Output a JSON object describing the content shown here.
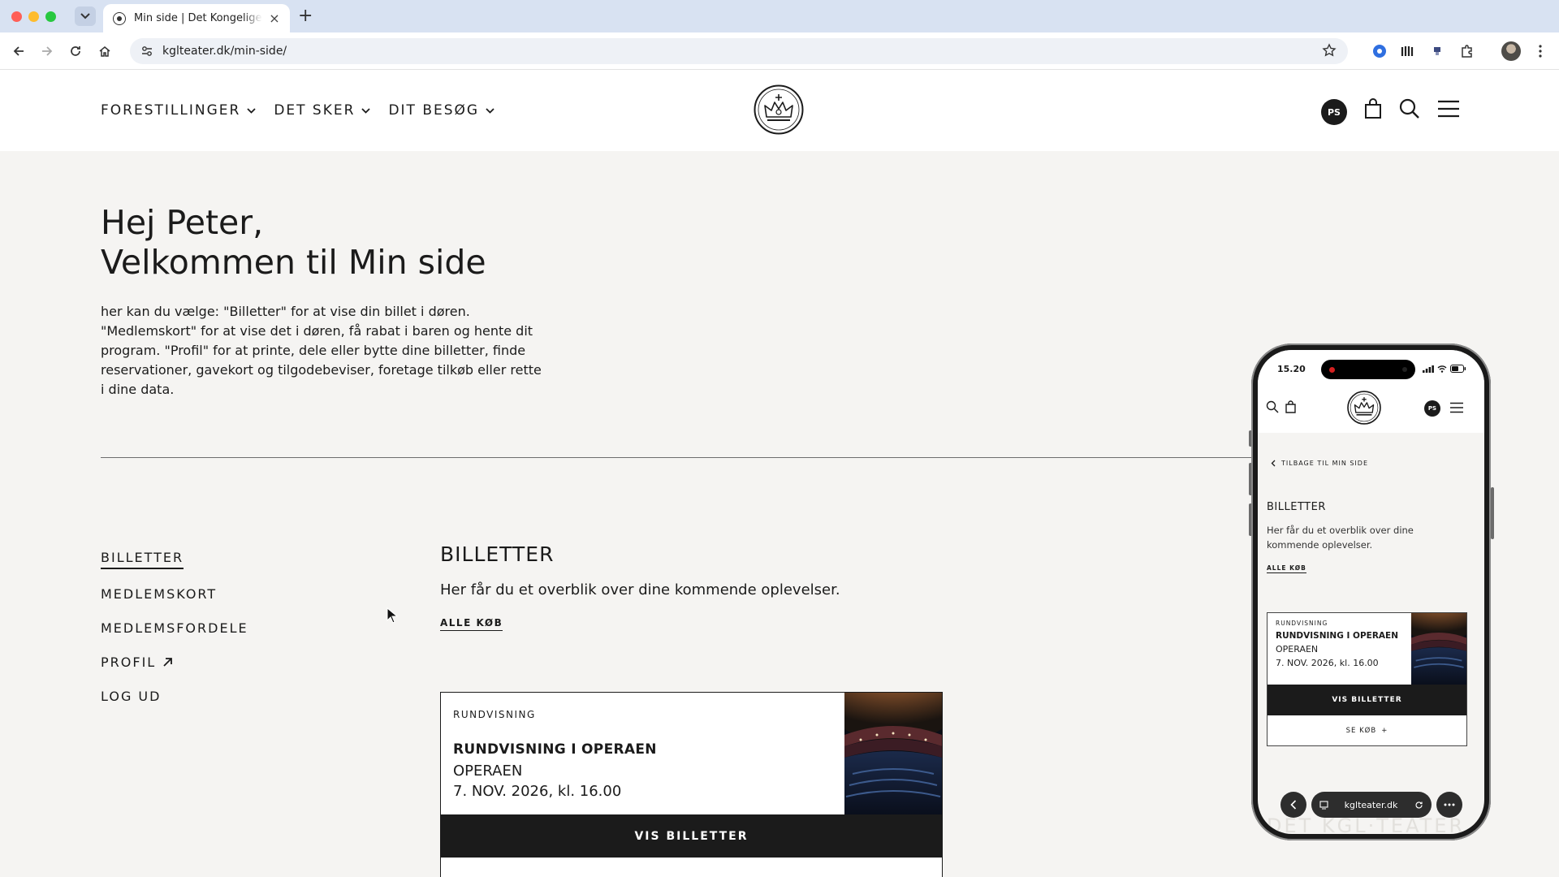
{
  "browser": {
    "tab_title": "Min side | Det Kongelige Teater",
    "url": "kglteater.dk/min-side/"
  },
  "header": {
    "nav": [
      {
        "label": "FORESTILLINGER"
      },
      {
        "label": "DET SKER"
      },
      {
        "label": "DIT BESØG"
      }
    ],
    "avatar_initials": "PS"
  },
  "hero": {
    "greeting_line1": "Hej Peter,",
    "greeting_line2": "Velkommen til Min side",
    "intro": "her kan du vælge: \"Billetter\" for at vise din billet i døren. \"Medlemskort\" for at vise det i døren, få rabat i baren og hente dit program. \"Profil\" for at printe, dele eller bytte dine billetter, finde reservationer, gavekort og tilgodebeviser, foretage tilkøb eller rette i dine data."
  },
  "side_menu": {
    "items": [
      {
        "label": "BILLETTER"
      },
      {
        "label": "MEDLEMSKORT"
      },
      {
        "label": "MEDLEMSFORDELE"
      },
      {
        "label": "PROFIL"
      },
      {
        "label": "LOG UD"
      }
    ]
  },
  "tickets": {
    "title": "BILLETTER",
    "description": "Her får du et overblik over dine kommende oplevelser.",
    "all_link": "ALLE KØB",
    "card": {
      "kicker": "RUNDVISNING",
      "title": "RUNDVISNING I OPERAEN",
      "venue": "OPERAEN",
      "date": "7. NOV. 2026, kl. 16.00",
      "button": "VIS BILLETTER"
    }
  },
  "phone": {
    "time": "15.20",
    "avatar_initials": "PS",
    "back_link": "TILBAGE TIL MIN SIDE",
    "title": "BILLETTER",
    "description": "Her får du et overblik over dine kommende oplevelser.",
    "all_link": "ALLE KØB",
    "card": {
      "kicker": "RUNDVISNING",
      "title": "RUNDVISNING I OPERAEN",
      "venue": "OPERAEN",
      "date": "7. NOV. 2026, kl. 16.00",
      "button": "VIS BILLETTER",
      "secondary": "SE KØB"
    },
    "url": "kglteater.dk",
    "footer_text": "DET KGL·TEATER"
  },
  "colors": {
    "page_bg": "#f5f4f2",
    "ink": "#1b1b1b",
    "tabbar": "#d8e2f2"
  }
}
